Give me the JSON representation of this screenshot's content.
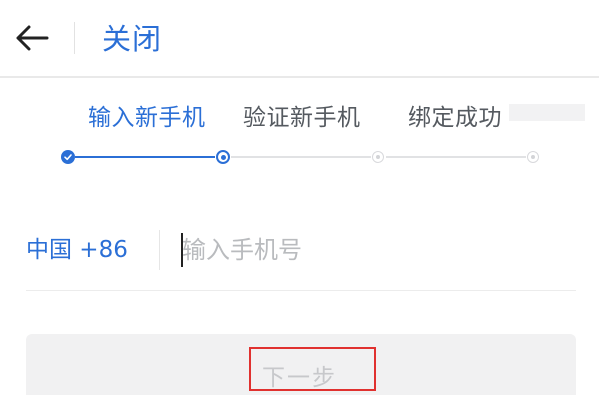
{
  "header": {
    "back_icon": "arrow-left-icon",
    "close_label": "关闭"
  },
  "steps": {
    "items": [
      {
        "label": "输入新手机",
        "state": "done"
      },
      {
        "label": "验证新手机",
        "state": "current"
      },
      {
        "label": "绑定成功",
        "state": "todo"
      }
    ]
  },
  "phone": {
    "country_code": "中国 +86",
    "placeholder": "输入手机号",
    "value": ""
  },
  "actions": {
    "next_label": "下一步"
  },
  "colors": {
    "accent": "#2b6fd6",
    "highlight": "#e0312f"
  }
}
